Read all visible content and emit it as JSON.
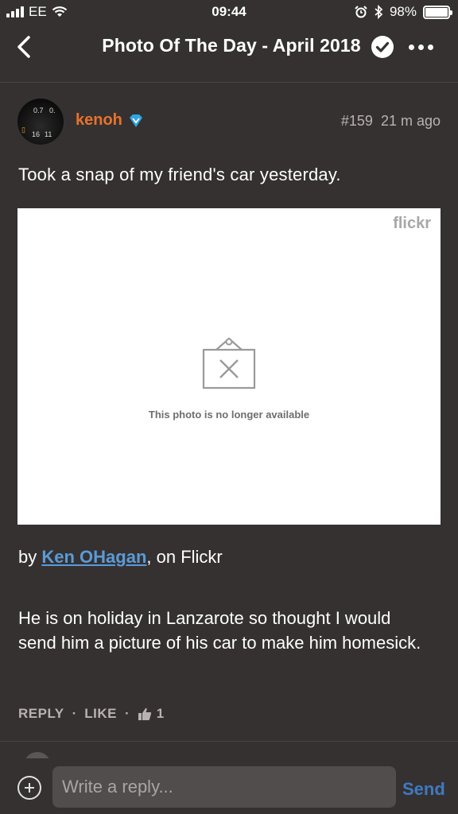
{
  "status_bar": {
    "carrier": "EE",
    "time": "09:44",
    "battery": "98%",
    "battery_level": 0.98
  },
  "nav": {
    "title": "Photo Of The Day - April 2018"
  },
  "post": {
    "username": "kenoh",
    "post_number": "#159",
    "time_ago": "21 m ago",
    "intro_text": "Took a snap of my friend's car yesterday.",
    "photo": {
      "brand": "flickr",
      "unavailable_message": "This photo is no longer available"
    },
    "credit_prefix": "by ",
    "credit_link": "Ken OHagan",
    "credit_suffix": ", on Flickr",
    "body": "He is on holiday in Lanzarote so thought I would send him a picture of his car to make him homesick.",
    "actions": {
      "reply": "REPLY",
      "like": "LIKE",
      "separator": "·",
      "like_count": "1"
    }
  },
  "composer": {
    "placeholder": "Write a reply...",
    "send_label": "Send"
  },
  "colors": {
    "background": "#353131",
    "username": "#e8722b",
    "link": "#5a9bd8",
    "send": "#3f7ac2",
    "verified": "#2ea6e6"
  }
}
